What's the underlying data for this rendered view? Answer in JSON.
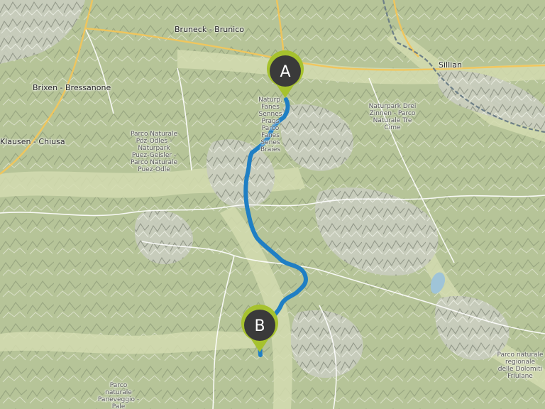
{
  "map": {
    "towns": {
      "bruneck": "Bruneck - Brunico",
      "brixen": "Brixen - Bressanone",
      "klausen": "Klausen - Chiusa",
      "sillian": "Sillian"
    },
    "parks": {
      "puez": "Parco Naturale Pöz-Odles - Naturpark Puez-Geisler - Parco Naturale Puez-Odle",
      "fanes": "Naturp. Fanes Sennes Prags Parco Fanes Senes Braies",
      "drei_zinnen": "Naturpark Drei Zinnen - Parco Naturale Tre Cime",
      "dolomiti_friulane": "Parco naturale regionale delle Dolomiti Friulane",
      "paneveggio": "Parco naturale Paneveggio - Pale"
    },
    "markers": {
      "start": "A",
      "end": "B"
    },
    "colors": {
      "route": "#1f7fc4",
      "marker_fill": "#3a3a3a",
      "marker_ring": "#a6c22e",
      "border": "#6d7f87",
      "major_road": "#f3c65a"
    }
  }
}
